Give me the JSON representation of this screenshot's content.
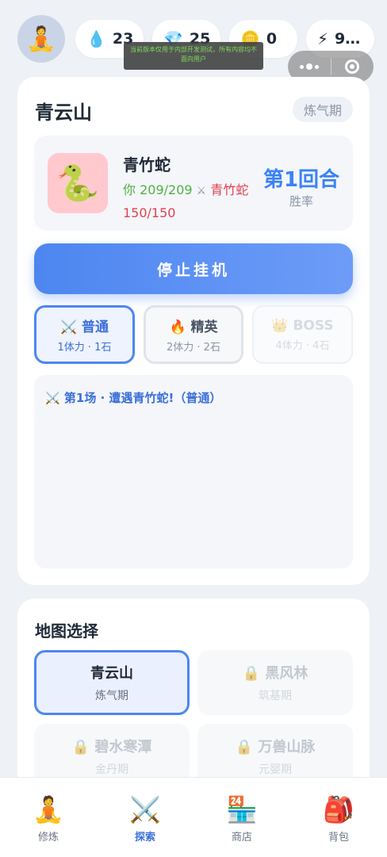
{
  "header": {
    "avatar_icon": "meditating-person",
    "resources": [
      {
        "icon": "water-drop-icon",
        "value": "23"
      },
      {
        "icon": "gem-icon",
        "value": "25"
      },
      {
        "icon": "coin-icon",
        "value": "0"
      },
      {
        "icon": "lightning-icon",
        "value": "9…"
      }
    ],
    "notice": "当前版本仅用于内部开发测试，所有内容均不面向用户"
  },
  "battle": {
    "map_name": "青云山",
    "realm": "炼气期",
    "enemy_name": "青竹蛇",
    "you_label": "你",
    "you_hp": "209/209",
    "vs_icon": "⚔",
    "enemy_label": "青竹蛇",
    "enemy_hp": "150/150",
    "round_label": "第1回合",
    "winrate_label": "胜率",
    "stop_button": "停止挂机"
  },
  "modes": [
    {
      "icon": "⚔️",
      "name": "普通",
      "cost": "1体力 · 1石",
      "state": "selected"
    },
    {
      "icon": "🔥",
      "name": "精英",
      "cost": "2体力 · 2石",
      "state": "available"
    },
    {
      "icon": "👑",
      "name": "BOSS",
      "cost": "4体力 · 4石",
      "state": "locked"
    }
  ],
  "log": [
    {
      "icon": "⚔️",
      "text": "第1场 · 遭遇青竹蛇!（普通）"
    }
  ],
  "map_select": {
    "title": "地图选择",
    "maps": [
      {
        "name": "青云山",
        "realm": "炼气期",
        "locked": false,
        "selected": true
      },
      {
        "name": "黑风林",
        "realm": "筑基期",
        "locked": true
      },
      {
        "name": "碧水寒潭",
        "realm": "金丹期",
        "locked": true
      },
      {
        "name": "万兽山脉",
        "realm": "元婴期",
        "locked": true
      }
    ]
  },
  "nav": [
    {
      "icon": "🧘",
      "label": "修炼",
      "active": false
    },
    {
      "icon": "⚔️",
      "label": "探索",
      "active": true
    },
    {
      "icon": "🏪",
      "label": "商店",
      "active": false
    },
    {
      "icon": "🎒",
      "label": "背包",
      "active": false
    }
  ],
  "colors": {
    "accent": "#4d86f0",
    "hp_you": "#52b043",
    "hp_enemy": "#e0414f",
    "enemy_bg": "#ffc9cd"
  }
}
